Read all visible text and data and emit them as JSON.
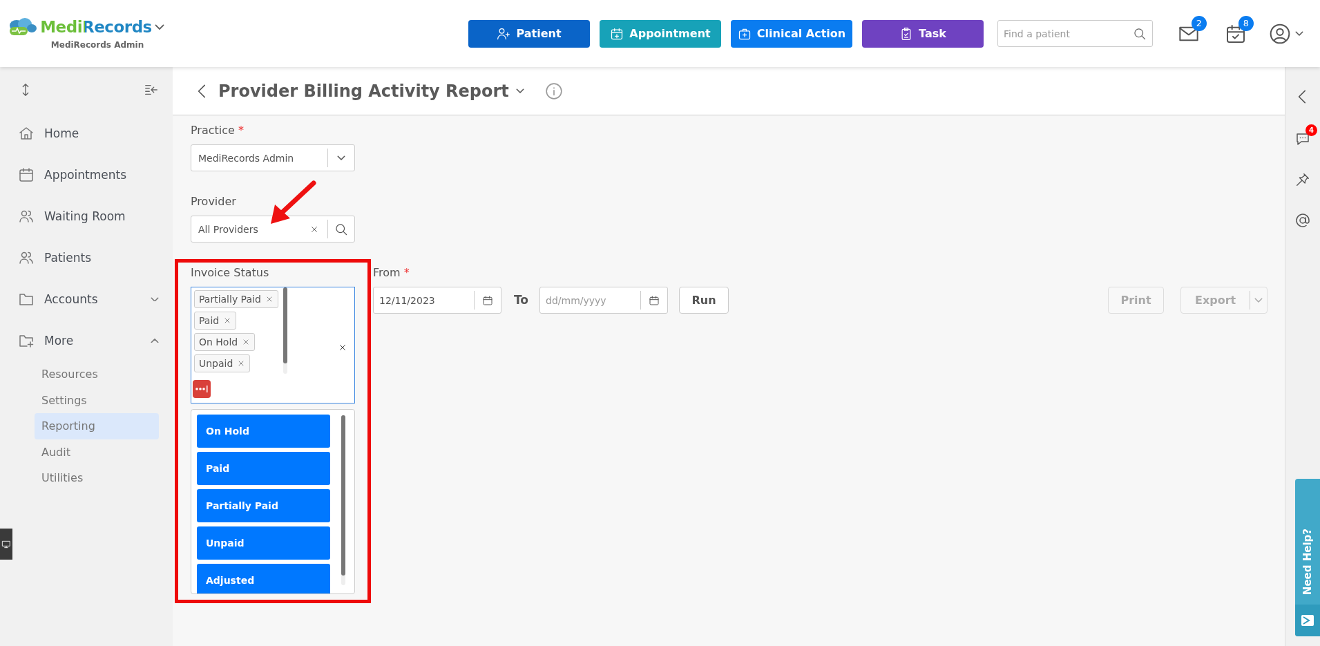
{
  "header": {
    "brand": "MediRecords",
    "practice": "MediRecords Admin",
    "actions": [
      {
        "label": "Patient",
        "color": "#0a64c8"
      },
      {
        "label": "Appointment",
        "color": "#17a2b8"
      },
      {
        "label": "Clinical Action",
        "color": "#0a7cf0"
      },
      {
        "label": "Task",
        "color": "#6f42c1"
      }
    ],
    "search": {
      "placeholder": "Find a patient"
    },
    "mail_count": "2",
    "calendar_count": "8"
  },
  "sidebar": {
    "items": [
      {
        "kind": "link",
        "label": "Home",
        "selected": false
      },
      {
        "kind": "link",
        "label": "Appointments",
        "selected": false
      },
      {
        "kind": "link",
        "label": "Waiting Room",
        "selected": false
      },
      {
        "kind": "link",
        "label": "Patients",
        "selected": false
      },
      {
        "kind": "group",
        "label": "Accounts",
        "selected": false,
        "expanded": false
      },
      {
        "kind": "group",
        "label": "More",
        "selected": false,
        "expanded": true,
        "children": [
          {
            "label": "Resources",
            "selected": false
          },
          {
            "label": "Settings",
            "selected": false
          },
          {
            "label": "Reporting",
            "selected": true
          },
          {
            "label": "Audit",
            "selected": false
          },
          {
            "label": "Utilities",
            "selected": false
          }
        ]
      }
    ]
  },
  "report": {
    "title": "Provider Billing Activity Report"
  },
  "form": {
    "practice": {
      "label": "Practice",
      "required_mark": "*",
      "value": "MediRecords Admin"
    },
    "provider": {
      "label": "Provider",
      "value": "All Providers"
    },
    "invoice_status": {
      "label": "Invoice Status",
      "tags": [
        "Partially Paid",
        "Paid",
        "On Hold",
        "Unpaid"
      ],
      "options": [
        "On Hold",
        "Paid",
        "Partially Paid",
        "Unpaid",
        "Adjusted"
      ]
    },
    "from": {
      "label": "From",
      "required_mark": "*",
      "value": "12/11/2023"
    },
    "to": {
      "label": "To",
      "placeholder": "dd/mm/yyyy"
    },
    "run_button": "Run",
    "print_button": {
      "label": "Print",
      "disabled": true
    },
    "export_button": {
      "label": "Export",
      "disabled": true
    }
  },
  "right_rail": {
    "chat_count": "4"
  },
  "help_tab": {
    "label": "Need Help?"
  }
}
